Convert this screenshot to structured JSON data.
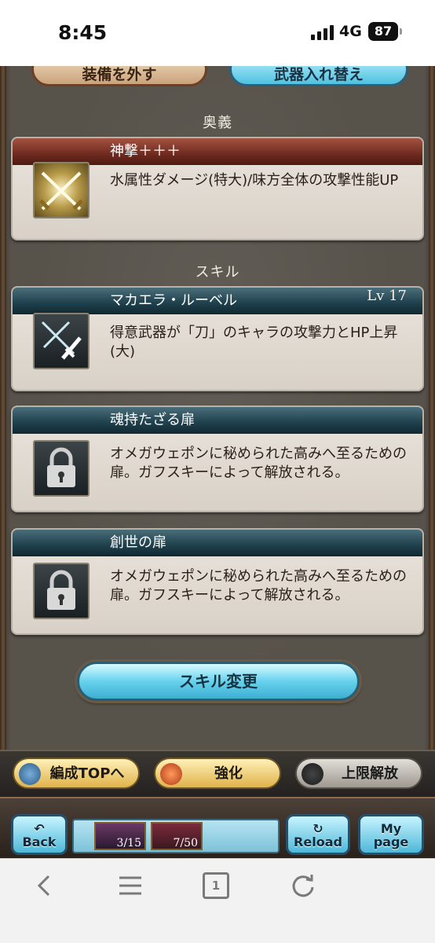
{
  "status_bar": {
    "time": "8:45",
    "network": "4G",
    "battery": "87"
  },
  "top_buttons": {
    "remove_equipment": "装備を外す",
    "swap_weapon": "武器入れ替え"
  },
  "ougi": {
    "section_title": "奥義",
    "name": "神撃＋＋＋",
    "description": "水属性ダメージ(特大)/味方全体の攻撃性能UP",
    "icon": "crossed-swords-icon"
  },
  "skills": {
    "section_title": "スキル",
    "items": [
      {
        "name": "マカエラ・ルーベル",
        "level": "Lv 17",
        "description": "得意武器が「刀」のキャラの攻撃力とHP上昇(大)",
        "icon": "sword-skill-icon"
      },
      {
        "name": "魂持たざる扉",
        "level": "",
        "description": "オメガウェポンに秘められた高みへ至るための扉。ガフスキーによって解放される。",
        "icon": "lock-icon"
      },
      {
        "name": "創世の扉",
        "level": "",
        "description": "オメガウェポンに秘められた高みへ至るための扉。ガフスキーによって解放される。",
        "icon": "lock-icon"
      }
    ],
    "change_button": "スキル変更"
  },
  "nav": {
    "party_top": "編成TOPへ",
    "enhance": "強化",
    "limit_break": "上限解放"
  },
  "command_bar": {
    "back": "Back",
    "reload": "Reload",
    "mypage_1": "My",
    "mypage_2": "page",
    "item1_count": "3/15",
    "item2_count": "7/50"
  },
  "browser": {
    "tabs_count": "1"
  },
  "colors": {
    "ougi_header": "#6e2a1f",
    "skill_header": "#1e3f4c",
    "cyan_button": "#67d2ee",
    "gold_button": "#e0b24a"
  }
}
